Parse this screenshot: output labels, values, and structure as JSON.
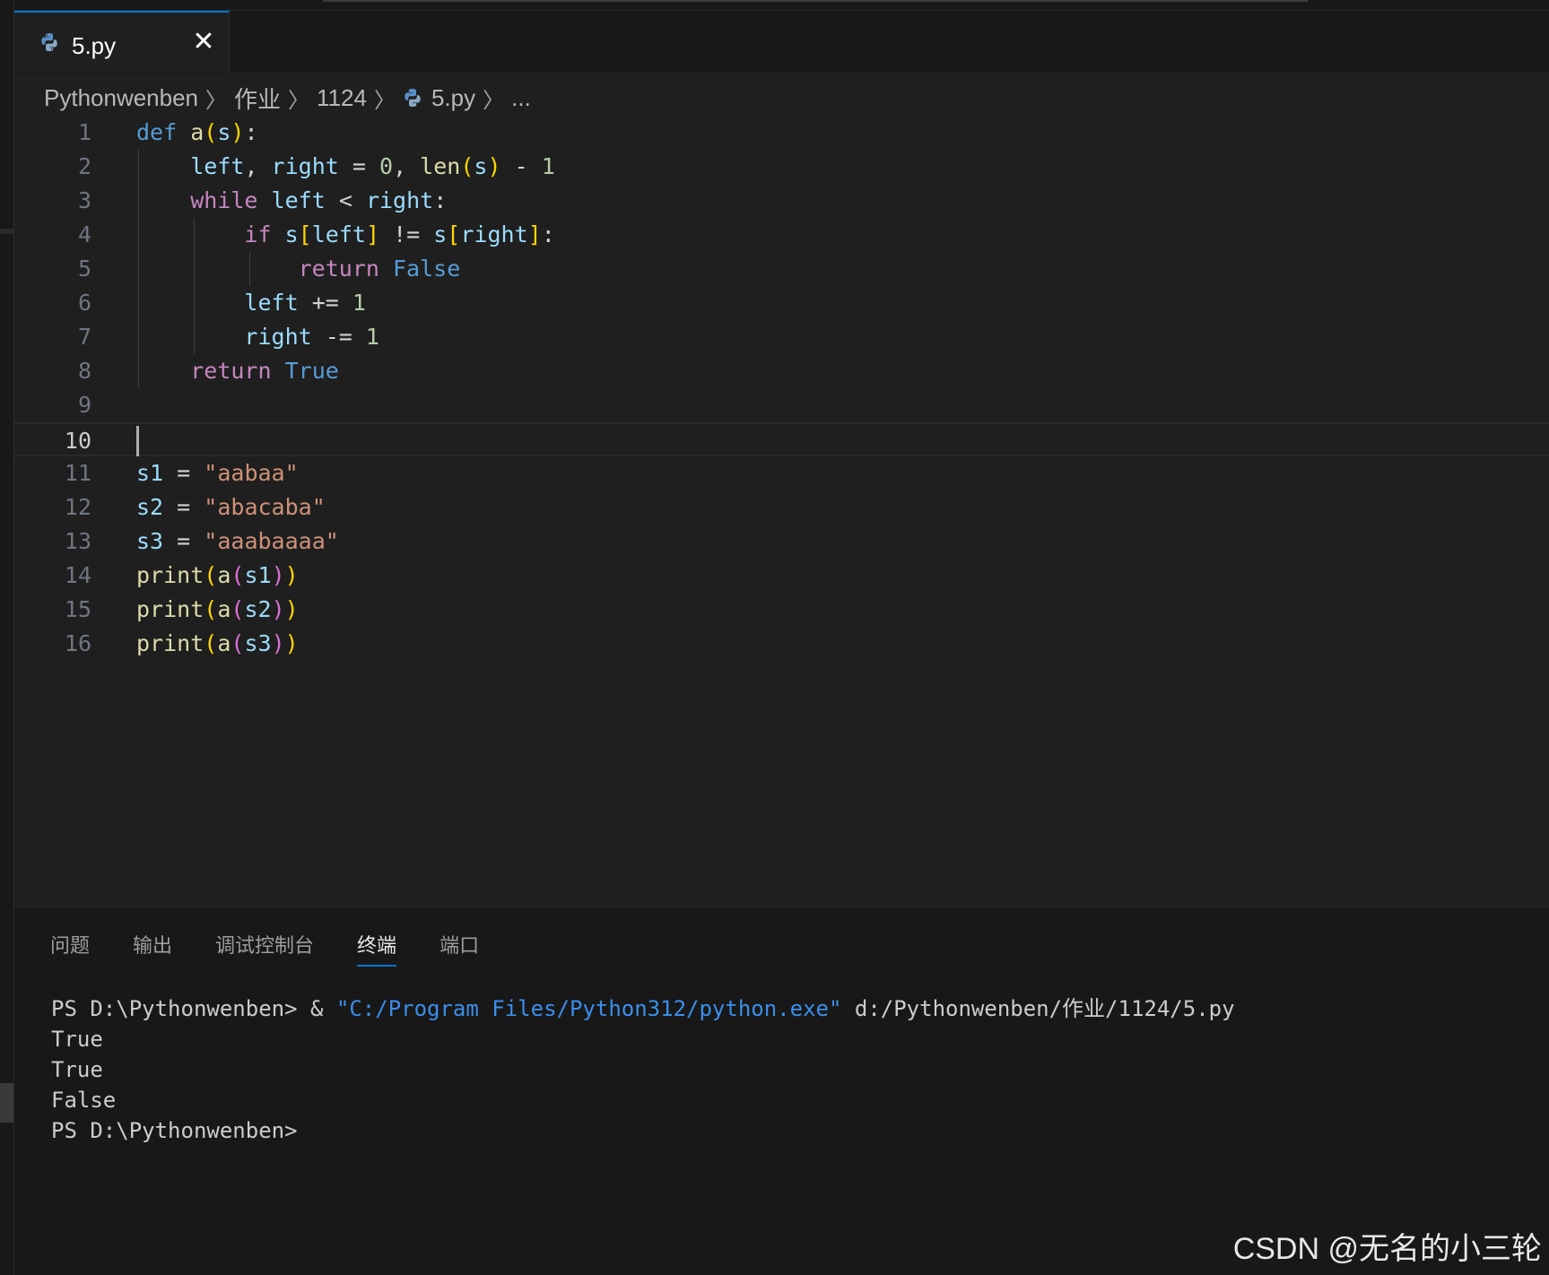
{
  "tab": {
    "label": "5.py",
    "close_glyph": "✕"
  },
  "breadcrumb": {
    "items": [
      "Pythonwenben",
      "作业",
      "1124"
    ],
    "file": "5.py",
    "more": "..."
  },
  "editor": {
    "current_line": 10,
    "lines": [
      {
        "n": "1"
      },
      {
        "n": "2"
      },
      {
        "n": "3"
      },
      {
        "n": "4"
      },
      {
        "n": "5"
      },
      {
        "n": "6"
      },
      {
        "n": "7"
      },
      {
        "n": "8"
      },
      {
        "n": "9"
      },
      {
        "n": "10"
      },
      {
        "n": "11"
      },
      {
        "n": "12"
      },
      {
        "n": "13"
      },
      {
        "n": "14"
      },
      {
        "n": "15"
      },
      {
        "n": "16"
      }
    ],
    "code": [
      "def a(s):",
      "    left, right = 0, len(s) - 1",
      "    while left < right:",
      "        if s[left] != s[right]:",
      "            return False",
      "        left += 1",
      "        right -= 1",
      "    return True",
      "",
      "",
      "s1 = \"aabaa\"",
      "s2 = \"abacaba\"",
      "s3 = \"aaabaaaa\"",
      "print(a(s1))",
      "print(a(s2))",
      "print(a(s3))"
    ]
  },
  "panel": {
    "tabs": [
      "问题",
      "输出",
      "调试控制台",
      "终端",
      "端口"
    ],
    "active_tab": "终端",
    "terminal": {
      "prompt1": "PS D:\\Pythonwenben> & ",
      "exe": "\"C:/Program Files/Python312/python.exe\"",
      "arg": " d:/Pythonwenben/作业/1124/5.py",
      "out1": "True",
      "out2": "True",
      "out3": "False",
      "prompt2": "PS D:\\Pythonwenben>"
    }
  },
  "watermark": "CSDN @无名的小三轮",
  "colors": {
    "accent": "#0078d4",
    "editor_bg": "#1f1f1f",
    "panel_bg": "#181818",
    "keyword": "#569cd6",
    "control": "#c586c0",
    "function": "#dcdcaa",
    "variable": "#9cdcfe",
    "number": "#b5cea8",
    "string": "#ce9178"
  }
}
